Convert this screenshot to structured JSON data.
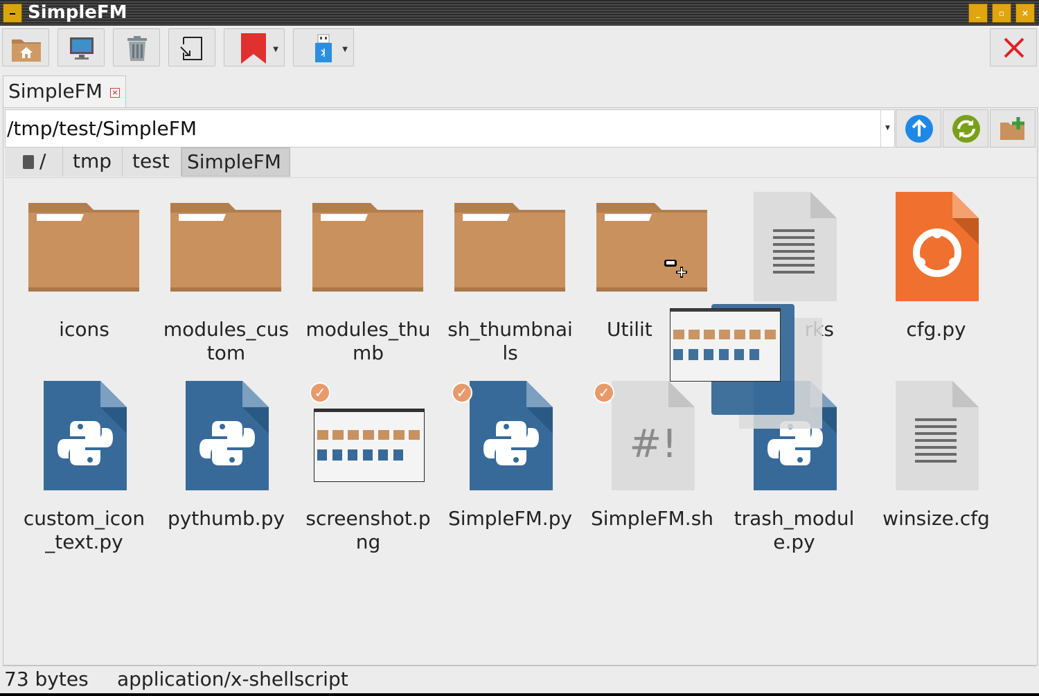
{
  "window": {
    "title": "SimpleFM",
    "controls": [
      "_",
      "▫",
      "×"
    ]
  },
  "toolbar": {
    "buttons": [
      {
        "name": "home",
        "icon": "home-folder-icon"
      },
      {
        "name": "computer",
        "icon": "monitor-icon"
      },
      {
        "name": "trash",
        "icon": "trash-icon"
      },
      {
        "name": "go-to",
        "icon": "jump-icon"
      },
      {
        "name": "bookmarks",
        "icon": "bookmark-icon"
      },
      {
        "name": "drives",
        "icon": "usb-drive-icon"
      }
    ],
    "close": "close-icon"
  },
  "tab": {
    "label": "SimpleFM"
  },
  "path": {
    "value": "/tmp/test/SimpleFM"
  },
  "breadcrumbs": [
    {
      "label": "/"
    },
    {
      "label": "tmp"
    },
    {
      "label": "test"
    },
    {
      "label": "SimpleFM"
    }
  ],
  "files": [
    {
      "name": "icons",
      "kind": "folder"
    },
    {
      "name": "modules_custom",
      "kind": "folder"
    },
    {
      "name": "modules_thumb",
      "kind": "folder"
    },
    {
      "name": "sh_thumbnails",
      "kind": "folder"
    },
    {
      "name": "Utilit",
      "kind": "folder"
    },
    {
      "name": "rks",
      "kind": "text"
    },
    {
      "name": "cfg.py",
      "kind": "config-orange"
    },
    {
      "name": "custom_icon_text.py",
      "kind": "python"
    },
    {
      "name": "pythumb.py",
      "kind": "python"
    },
    {
      "name": "screenshot.png",
      "kind": "image",
      "selected": true
    },
    {
      "name": "SimpleFM.py",
      "kind": "python",
      "selected": true
    },
    {
      "name": "SimpleFM.sh",
      "kind": "shell",
      "selected": true
    },
    {
      "name": "trash_module.py",
      "kind": "python"
    },
    {
      "name": "winsize.cfg",
      "kind": "text"
    }
  ],
  "status": {
    "size": "73 bytes",
    "mime": "application/x-shellscript"
  },
  "colors": {
    "folder": "#c8915e",
    "python": "#376a98",
    "orange": "#f07030",
    "select": "#e89a6a"
  }
}
